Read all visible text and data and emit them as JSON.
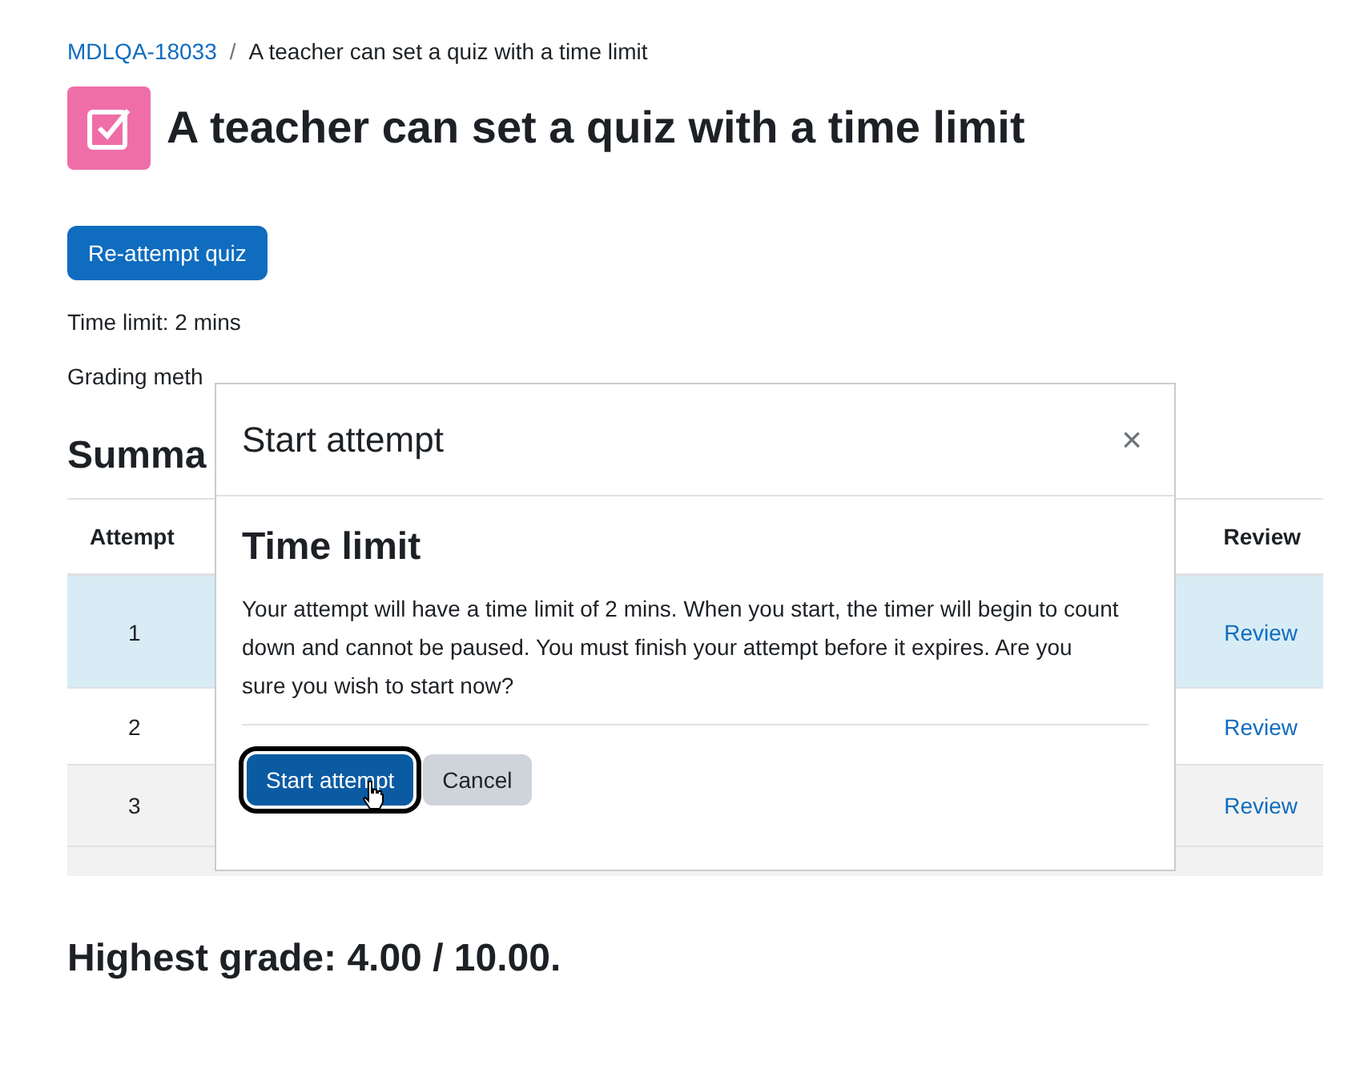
{
  "breadcrumb": [
    {
      "label": "MDLQA-18033",
      "kind": "link"
    },
    {
      "label": "A teacher can set a quiz with a time limit",
      "kind": "current"
    }
  ],
  "breadcrumb_separator": "/",
  "page_title": "A teacher can set a quiz with a time limit",
  "reattempt_button": "Re-attempt quiz",
  "info": [
    "Time limit: 2 mins",
    "Grading meth"
  ],
  "summary_heading": "Summa",
  "table": {
    "columns": [
      "Attempt",
      "Review"
    ],
    "rows": [
      {
        "attempt": "1",
        "review": "Review",
        "selected": true
      },
      {
        "attempt": "2",
        "review": "Review",
        "selected": false
      },
      {
        "attempt": "3",
        "review": "Review",
        "selected": false
      }
    ]
  },
  "highest_grade": "Highest grade: 4.00 / 10.00.",
  "dialog": {
    "title": "Start attempt",
    "close": "×",
    "heading": "Time limit",
    "message": "Your attempt will have a time limit of 2 mins. When you start, the timer will begin to count down and cannot be paused. You must finish your attempt before it expires. Are you sure you wish to start now?",
    "buttons": [
      {
        "label": "Start attempt",
        "kind": "primary",
        "focused": true
      },
      {
        "label": "Cancel",
        "kind": "secondary",
        "focused": false
      }
    ]
  }
}
